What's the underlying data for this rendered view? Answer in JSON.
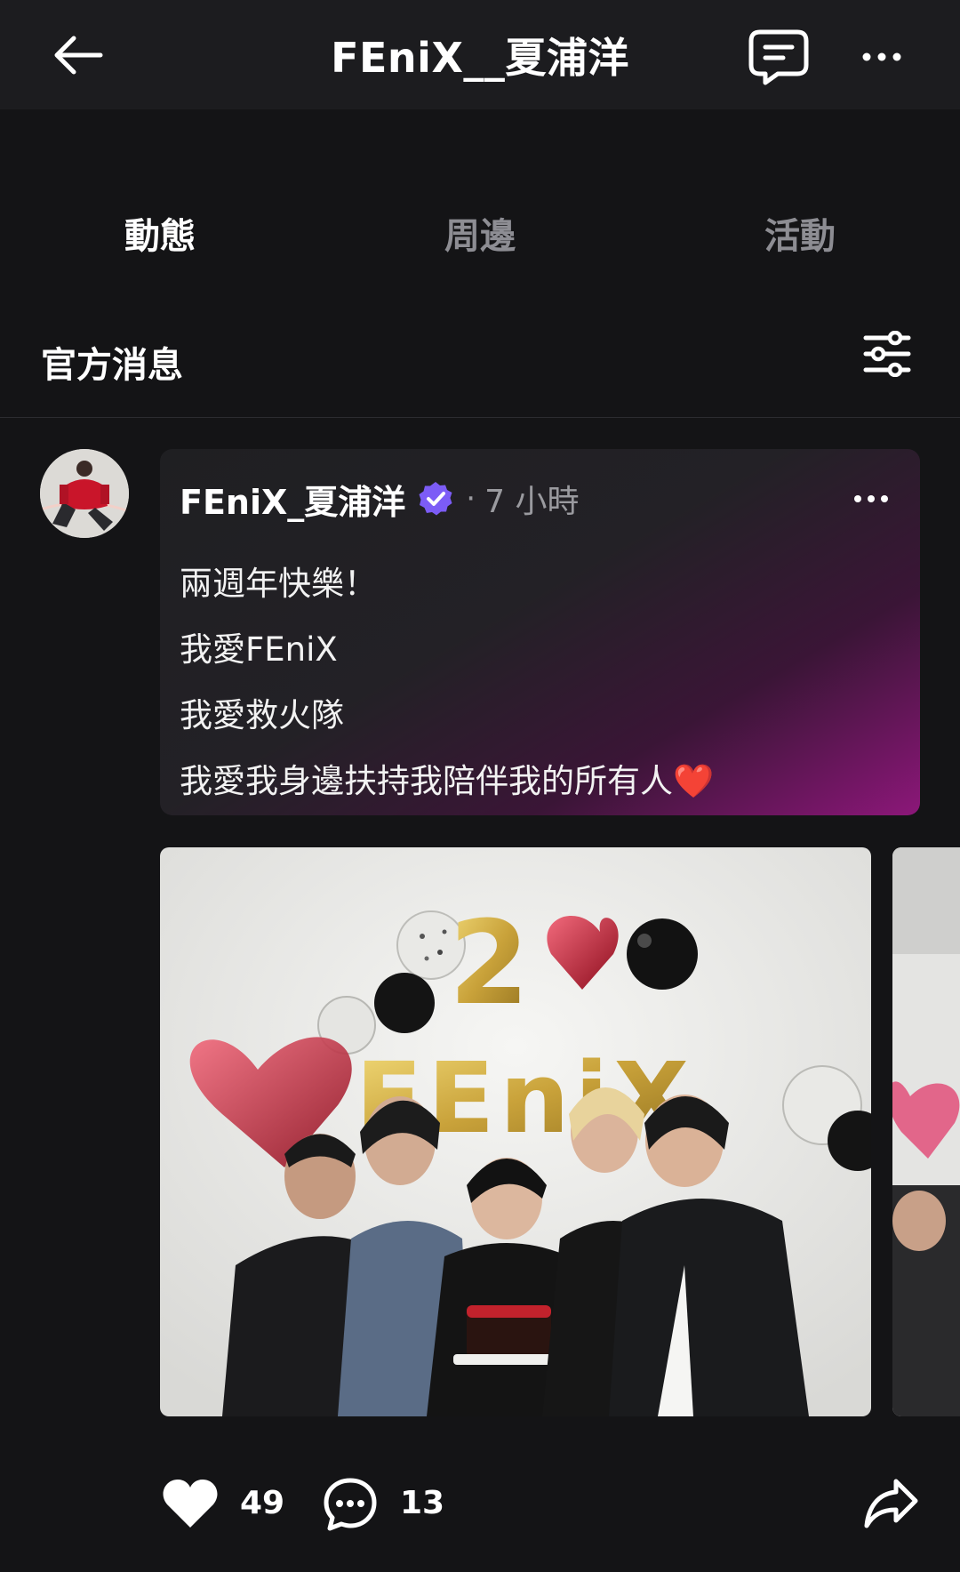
{
  "header": {
    "title": "FEniX__夏浦洋",
    "back_icon": "arrow-left-icon",
    "chat_icon": "chat-bubble-icon",
    "more_icon": "more-horizontal-icon"
  },
  "tabs": [
    {
      "label": "動態",
      "active": true
    },
    {
      "label": "周邊",
      "active": false
    },
    {
      "label": "活動",
      "active": false
    }
  ],
  "section": {
    "title": "官方消息",
    "filter_icon": "sliders-icon"
  },
  "post": {
    "author": "FEniX_夏浦洋",
    "verified": true,
    "separator": "·",
    "time": "7 小時",
    "lines": [
      "兩週年快樂！",
      "我愛FEniX",
      "我愛救火隊",
      "我愛我身邊扶持我陪伴我的所有人❤️"
    ],
    "photos": [
      {
        "description": "group-photo-anniversary"
      },
      {
        "description": "group-photo-second"
      }
    ],
    "likes": "49",
    "comments": "13"
  },
  "colors": {
    "background": "#141416",
    "header_bg": "#1c1c1f",
    "accent_verified": "#7c5cf6",
    "card_gradient_end": "#8c1779",
    "heart": "#ffffff"
  }
}
